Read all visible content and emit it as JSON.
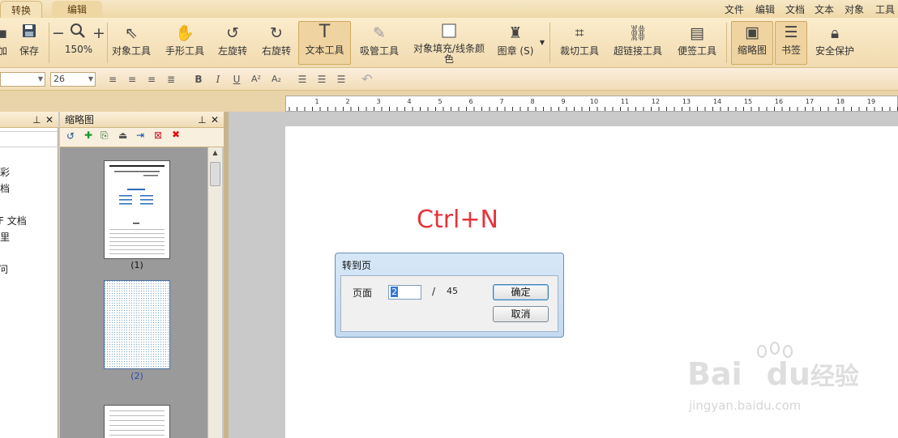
{
  "tabs": [
    {
      "label": "转换",
      "active": true
    },
    {
      "label": "编辑",
      "active": false
    }
  ],
  "menu": [
    "文件",
    "编辑",
    "文档",
    "文本",
    "对象",
    "工具"
  ],
  "ribbon": {
    "partial_first": "加",
    "save": "保存",
    "zoom_value": "150%",
    "zoom_out": "−",
    "zoom_in": "+",
    "tools": [
      {
        "label": "对象工具",
        "icon": "cursor-icon"
      },
      {
        "label": "手形工具",
        "icon": "hand-icon"
      },
      {
        "label": "左旋转",
        "icon": "rotate-left-icon"
      },
      {
        "label": "右旋转",
        "icon": "rotate-right-icon"
      },
      {
        "label": "文本工具",
        "icon": "text-tool-icon",
        "active": true
      },
      {
        "label": "吸管工具",
        "icon": "eyedropper-icon"
      },
      {
        "label": "对象填充/线条颜色",
        "icon": "fill-color-icon"
      },
      {
        "label": "图章 (S)",
        "icon": "stamp-icon"
      },
      {
        "label": "裁切工具",
        "icon": "crop-icon"
      },
      {
        "label": "超链接工具",
        "icon": "link-icon"
      },
      {
        "label": "便签工具",
        "icon": "note-icon"
      },
      {
        "label": "缩略图",
        "icon": "thumbnail-icon",
        "active": true
      },
      {
        "label": "书签",
        "icon": "bookmark-list-icon",
        "active": true
      },
      {
        "label": "安全保护",
        "icon": "lock-icon"
      }
    ]
  },
  "formatbar": {
    "font_size": "26",
    "buttons": [
      "B",
      "I",
      "U",
      "A²",
      "A₂"
    ]
  },
  "ruler_numbers": [
    "1",
    "2",
    "3",
    "4",
    "5",
    "6",
    "7",
    "8",
    "9",
    "10",
    "11",
    "12",
    "13",
    "14",
    "15",
    "16",
    "17",
    "18",
    "19"
  ],
  "bookmark_pane": {
    "items": [
      "彩",
      "档",
      "F 文档",
      "里",
      "问"
    ]
  },
  "thumbnail_pane": {
    "title": "缩略图",
    "thumbs": [
      "(1)",
      "(2)",
      ""
    ]
  },
  "document": {
    "annotation": "Ctrl+N"
  },
  "dialog": {
    "title": "转到页",
    "page_label": "页面",
    "page_value": "2",
    "separator": "/",
    "total": "45",
    "ok": "确定",
    "cancel": "取消"
  },
  "watermark": {
    "brand": "Bai",
    "brand2": "du",
    "suffix": "经验",
    "url": "jingyan.baidu.com"
  }
}
